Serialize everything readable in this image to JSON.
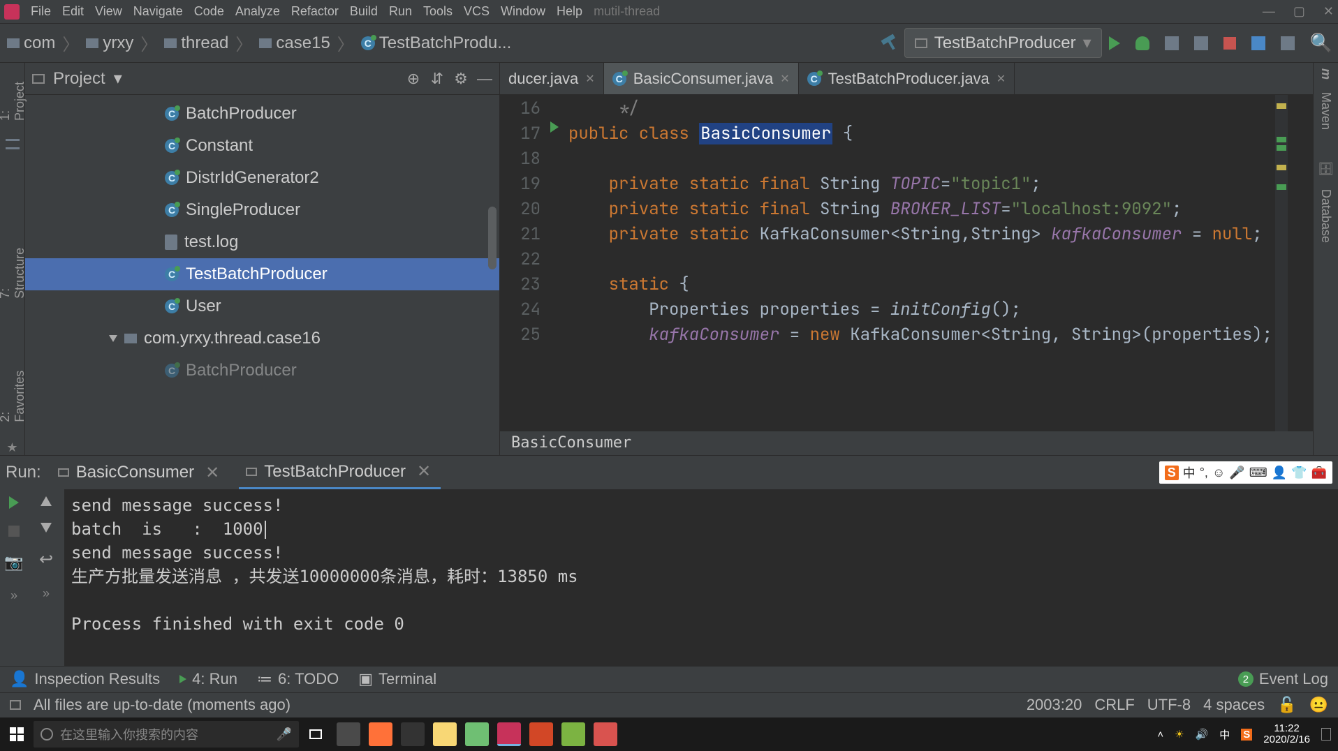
{
  "menu": {
    "items": [
      "File",
      "Edit",
      "View",
      "Navigate",
      "Code",
      "Analyze",
      "Refactor",
      "Build",
      "Run",
      "Tools",
      "VCS",
      "Window",
      "Help"
    ],
    "project": "mutil-thread"
  },
  "breadcrumbs": [
    {
      "icon": "folder",
      "label": "com"
    },
    {
      "icon": "folder",
      "label": "yrxy"
    },
    {
      "icon": "folder",
      "label": "thread"
    },
    {
      "icon": "folder",
      "label": "case15"
    },
    {
      "icon": "class",
      "label": "TestBatchProdu..."
    }
  ],
  "run_config": "TestBatchProducer",
  "left_tools": {
    "project": "1: Project",
    "structure": "7: Structure",
    "favorites": "2: Favorites"
  },
  "right_tools": {
    "maven": "Maven",
    "database": "Database"
  },
  "project_panel": {
    "title": "Project",
    "items": [
      {
        "icon": "class",
        "label": "BatchProducer"
      },
      {
        "icon": "class",
        "label": "Constant"
      },
      {
        "icon": "class",
        "label": "DistrIdGenerator2"
      },
      {
        "icon": "class",
        "label": "SingleProducer"
      },
      {
        "icon": "file",
        "label": "test.log"
      },
      {
        "icon": "class",
        "label": "TestBatchProducer",
        "selected": true
      },
      {
        "icon": "class",
        "label": "User"
      }
    ],
    "package": "com.yrxy.thread.case16",
    "package_extra": "BatchProducer"
  },
  "editor": {
    "tabs": [
      {
        "label": "ducer.java",
        "active": false,
        "icon": "none"
      },
      {
        "label": "BasicConsumer.java",
        "active": true,
        "icon": "class"
      },
      {
        "label": "TestBatchProducer.java",
        "active": false,
        "icon": "class"
      }
    ],
    "lines_start": 16,
    "lines": [
      "         */",
      "public class BasicConsumer {",
      "",
      "    private static final String TOPIC=\"topic1\";",
      "    private static final String BROKER_LIST=\"localhost:9092\";",
      "    private static KafkaConsumer<String,String> kafkaConsumer = null;",
      "",
      "    static {",
      "        Properties properties = initConfig();",
      "        kafkaConsumer = new KafkaConsumer<String, String>(properties);"
    ],
    "class_name": "BasicConsumer",
    "mini_crumb": "BasicConsumer"
  },
  "run_panel": {
    "title": "Run:",
    "tabs": [
      {
        "label": "BasicConsumer",
        "active": false
      },
      {
        "label": "TestBatchProducer",
        "active": true
      }
    ],
    "ime": {
      "logo": "S",
      "lang": "中"
    },
    "console_lines": [
      "send message success!",
      "batch  is   :  1000",
      "send message success!",
      "生产方批量发送消息 ，共发送10000000条消息，耗时：13850 ms",
      "",
      "Process finished with exit code 0"
    ]
  },
  "bottom_tools": {
    "inspection": "Inspection Results",
    "run": "4: Run",
    "todo": "6: TODO",
    "terminal": "Terminal",
    "eventlog": "Event Log",
    "eventlog_count": "2"
  },
  "statusbar": {
    "msg": "All files are up-to-date (moments ago)",
    "pos": "2003:20",
    "eol": "CRLF",
    "enc": "UTF-8",
    "indent": "4 spaces"
  },
  "taskbar": {
    "search_placeholder": "在这里输入你搜索的内容",
    "time": "11:22",
    "date": "2020/2/16",
    "lang": "中"
  }
}
